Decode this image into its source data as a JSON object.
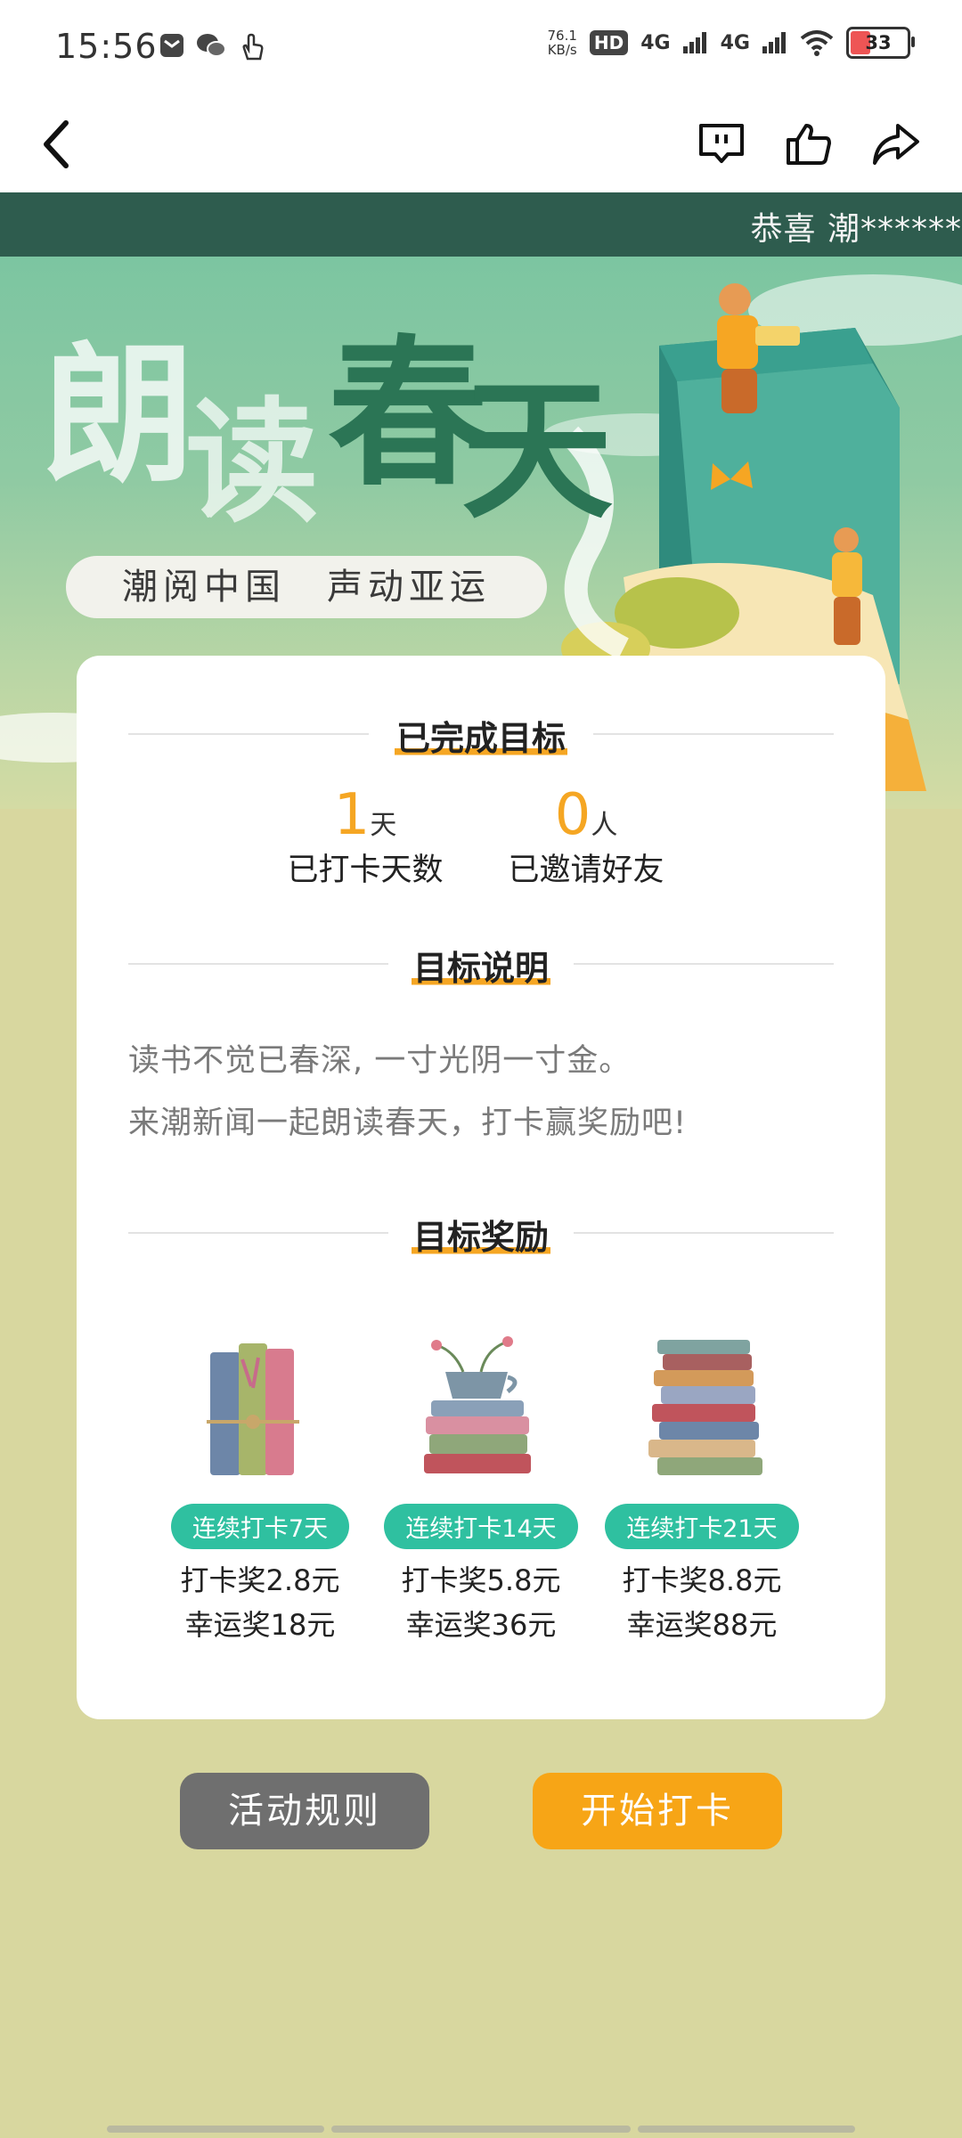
{
  "status_bar": {
    "time": "15:56",
    "net_speed_value": "76.1",
    "net_speed_unit": "KB/s",
    "hd_label": "HD",
    "sim1_label": "4G",
    "sim2_label": "4G",
    "battery_level": "33",
    "icons": [
      "inbox-icon",
      "wechat-icon",
      "touch-hand-icon",
      "wifi-icon",
      "battery-icon"
    ]
  },
  "nav": {
    "icons": [
      "back-arrow-icon",
      "comment-icon",
      "like-thumb-icon",
      "share-icon"
    ]
  },
  "notice": {
    "text": "恭喜 潮******"
  },
  "banner": {
    "title_chars": [
      "朗",
      "读",
      "春",
      "天"
    ],
    "slogan": "潮阅中国　声动亚运"
  },
  "completed": {
    "title": "已完成目标",
    "stats": [
      {
        "value": "1",
        "unit": "天",
        "label": "已打卡天数"
      },
      {
        "value": "0",
        "unit": "人",
        "label": "已邀请好友"
      }
    ]
  },
  "explanation": {
    "title": "目标说明",
    "lines": [
      "读书不觉已春深, 一寸光阴一寸金。",
      "来潮新闻一起朗读春天，打卡赢奖励吧!"
    ]
  },
  "rewards": {
    "title": "目标奖励",
    "items": [
      {
        "badge": "连续打卡7天",
        "line1": "打卡奖2.8元",
        "line2": "幸运奖18元"
      },
      {
        "badge": "连续打卡14天",
        "line1": "打卡奖5.8元",
        "line2": "幸运奖36元"
      },
      {
        "badge": "连续打卡21天",
        "line1": "打卡奖8.8元",
        "line2": "幸运奖88元"
      }
    ]
  },
  "buttons": {
    "rules": "活动规则",
    "start": "开始打卡"
  },
  "colors": {
    "accent": "#f5a623",
    "badge": "#2fc0a0",
    "notice_bg": "#2e5c4e",
    "page_bg": "#d8d79f"
  }
}
